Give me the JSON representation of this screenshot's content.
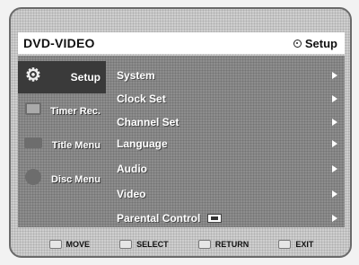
{
  "header": {
    "title": "DVD-VIDEO",
    "section_label": "Setup",
    "section_icon": "disc-icon"
  },
  "sidebar": {
    "items": [
      {
        "label": "Setup",
        "icon": "gear-icon",
        "active": true
      },
      {
        "label": "Timer Rec.",
        "icon": "timer-icon",
        "active": false
      },
      {
        "label": "Title Menu",
        "icon": "title-menu-icon",
        "active": false
      },
      {
        "label": "Disc Menu",
        "icon": "disc-menu-icon",
        "active": false
      }
    ]
  },
  "menu": {
    "items": [
      {
        "label": "System"
      },
      {
        "label": "Clock Set"
      },
      {
        "label": "Channel Set"
      },
      {
        "label": "Language"
      },
      {
        "label": "Audio"
      },
      {
        "label": "Video"
      },
      {
        "label": "Parental Control",
        "icon": "lock-icon"
      }
    ]
  },
  "footer": {
    "move": "MOVE",
    "select": "SELECT",
    "return": "RETURN",
    "exit": "EXIT"
  }
}
